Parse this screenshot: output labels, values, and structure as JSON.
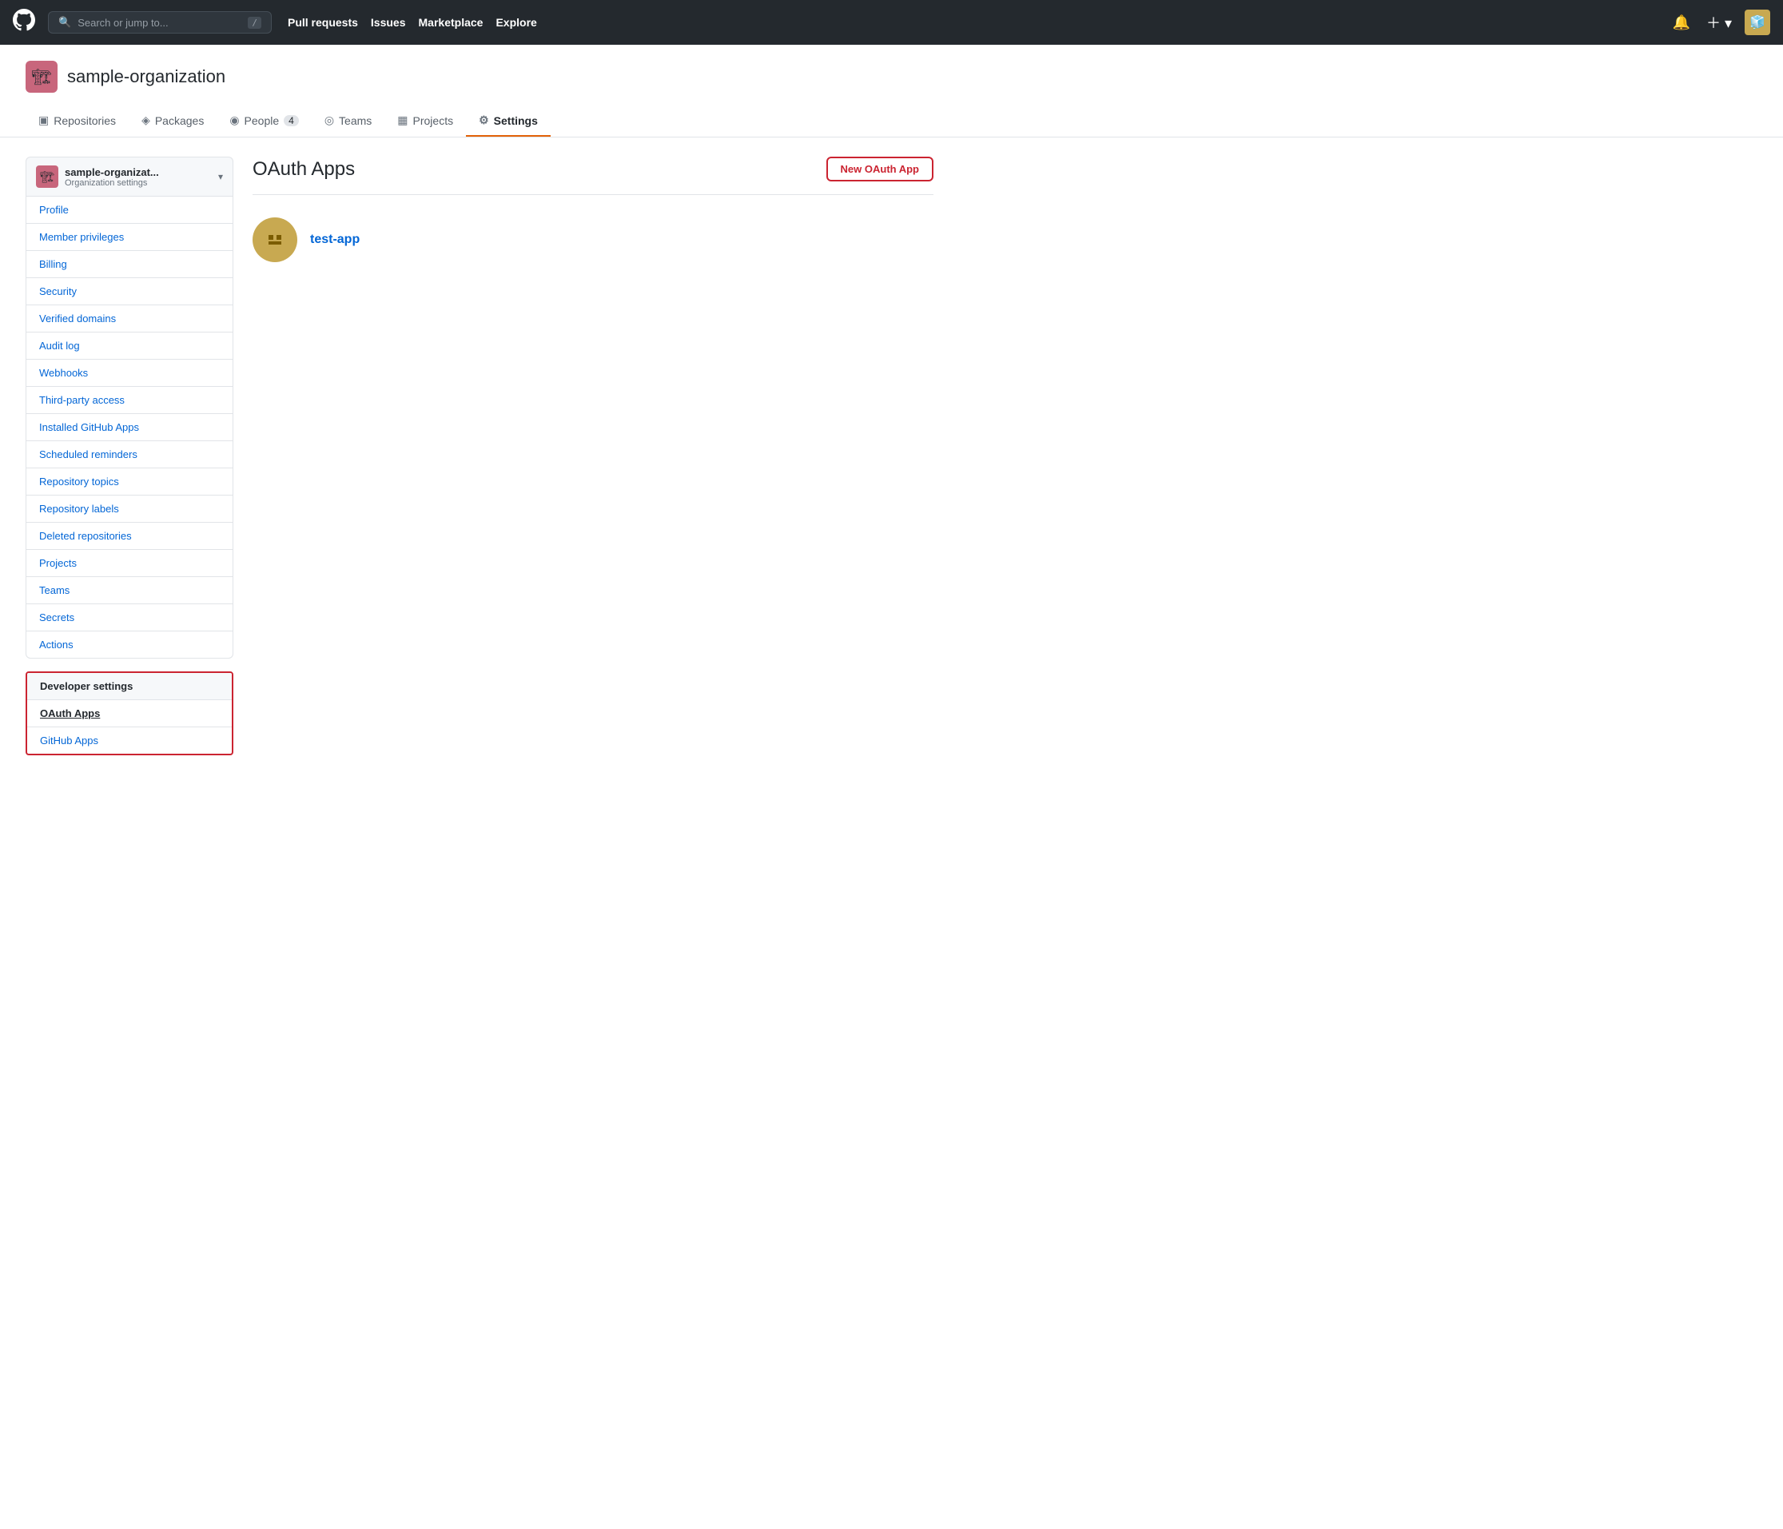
{
  "topnav": {
    "search_placeholder": "Search or jump to...",
    "search_kbd": "/",
    "links": [
      "Pull requests",
      "Issues",
      "Marketplace",
      "Explore"
    ],
    "logo_symbol": "⬤"
  },
  "org": {
    "name": "sample-organization",
    "avatar_emoji": "🏗",
    "tabs": [
      {
        "id": "repositories",
        "label": "Repositories",
        "icon": "▣",
        "badge": null
      },
      {
        "id": "packages",
        "label": "Packages",
        "icon": "◈",
        "badge": null
      },
      {
        "id": "people",
        "label": "People",
        "icon": "◉",
        "badge": "4"
      },
      {
        "id": "teams",
        "label": "Teams",
        "icon": "◎",
        "badge": null
      },
      {
        "id": "projects",
        "label": "Projects",
        "icon": "▦",
        "badge": null
      },
      {
        "id": "settings",
        "label": "Settings",
        "icon": "⚙",
        "badge": null,
        "active": true
      }
    ]
  },
  "sidebar": {
    "org_name": "sample-organizat...",
    "org_sub": "Organization settings",
    "nav_items": [
      "Profile",
      "Member privileges",
      "Billing",
      "Security",
      "Verified domains",
      "Audit log",
      "Webhooks",
      "Third-party access",
      "Installed GitHub Apps",
      "Scheduled reminders",
      "Repository topics",
      "Repository labels",
      "Deleted repositories",
      "Projects",
      "Teams",
      "Secrets",
      "Actions"
    ],
    "dev_section_header": "Developer settings",
    "oauth_apps_label": "OAuth Apps",
    "github_apps_label": "GitHub Apps"
  },
  "content": {
    "title": "OAuth Apps",
    "new_oauth_btn": "New OAuth App",
    "apps": [
      {
        "name": "test-app",
        "icon_emoji": "🏷"
      }
    ]
  }
}
